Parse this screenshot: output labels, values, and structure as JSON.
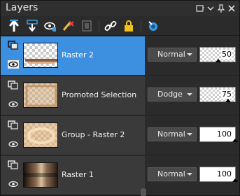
{
  "window": {
    "title": "Layers",
    "buttons": [
      "options-icon",
      "pin-icon",
      "close-icon"
    ]
  },
  "toolbar": {
    "tools": [
      "new-raster-layer-icon",
      "merge-down-icon",
      "visibility-toggle-icon",
      "delete-layer-icon",
      "mask-icon",
      "link-icon",
      "lock-icon",
      "palette-icon"
    ]
  },
  "layers": [
    {
      "name": "Raster 2",
      "blend_mode": "Normal",
      "opacity": "50",
      "opacity_fraction": 0.5,
      "selected": true,
      "thumb": "raster2"
    },
    {
      "name": "Promoted Selection",
      "blend_mode": "Dodge",
      "opacity": "75",
      "opacity_fraction": 0.75,
      "selected": false,
      "thumb": "promoted"
    },
    {
      "name": "Group - Raster 2",
      "blend_mode": "Normal",
      "opacity": "100",
      "opacity_fraction": 1.0,
      "selected": false,
      "thumb": "group"
    },
    {
      "name": "Raster 1",
      "blend_mode": "Normal",
      "opacity": "100",
      "opacity_fraction": 1.0,
      "selected": false,
      "thumb": "raster1"
    }
  ],
  "colors": {
    "selected_row": "#3d8fe0",
    "row_bg": "#3a3a3a",
    "panel_bg": "#2b2b2b"
  }
}
